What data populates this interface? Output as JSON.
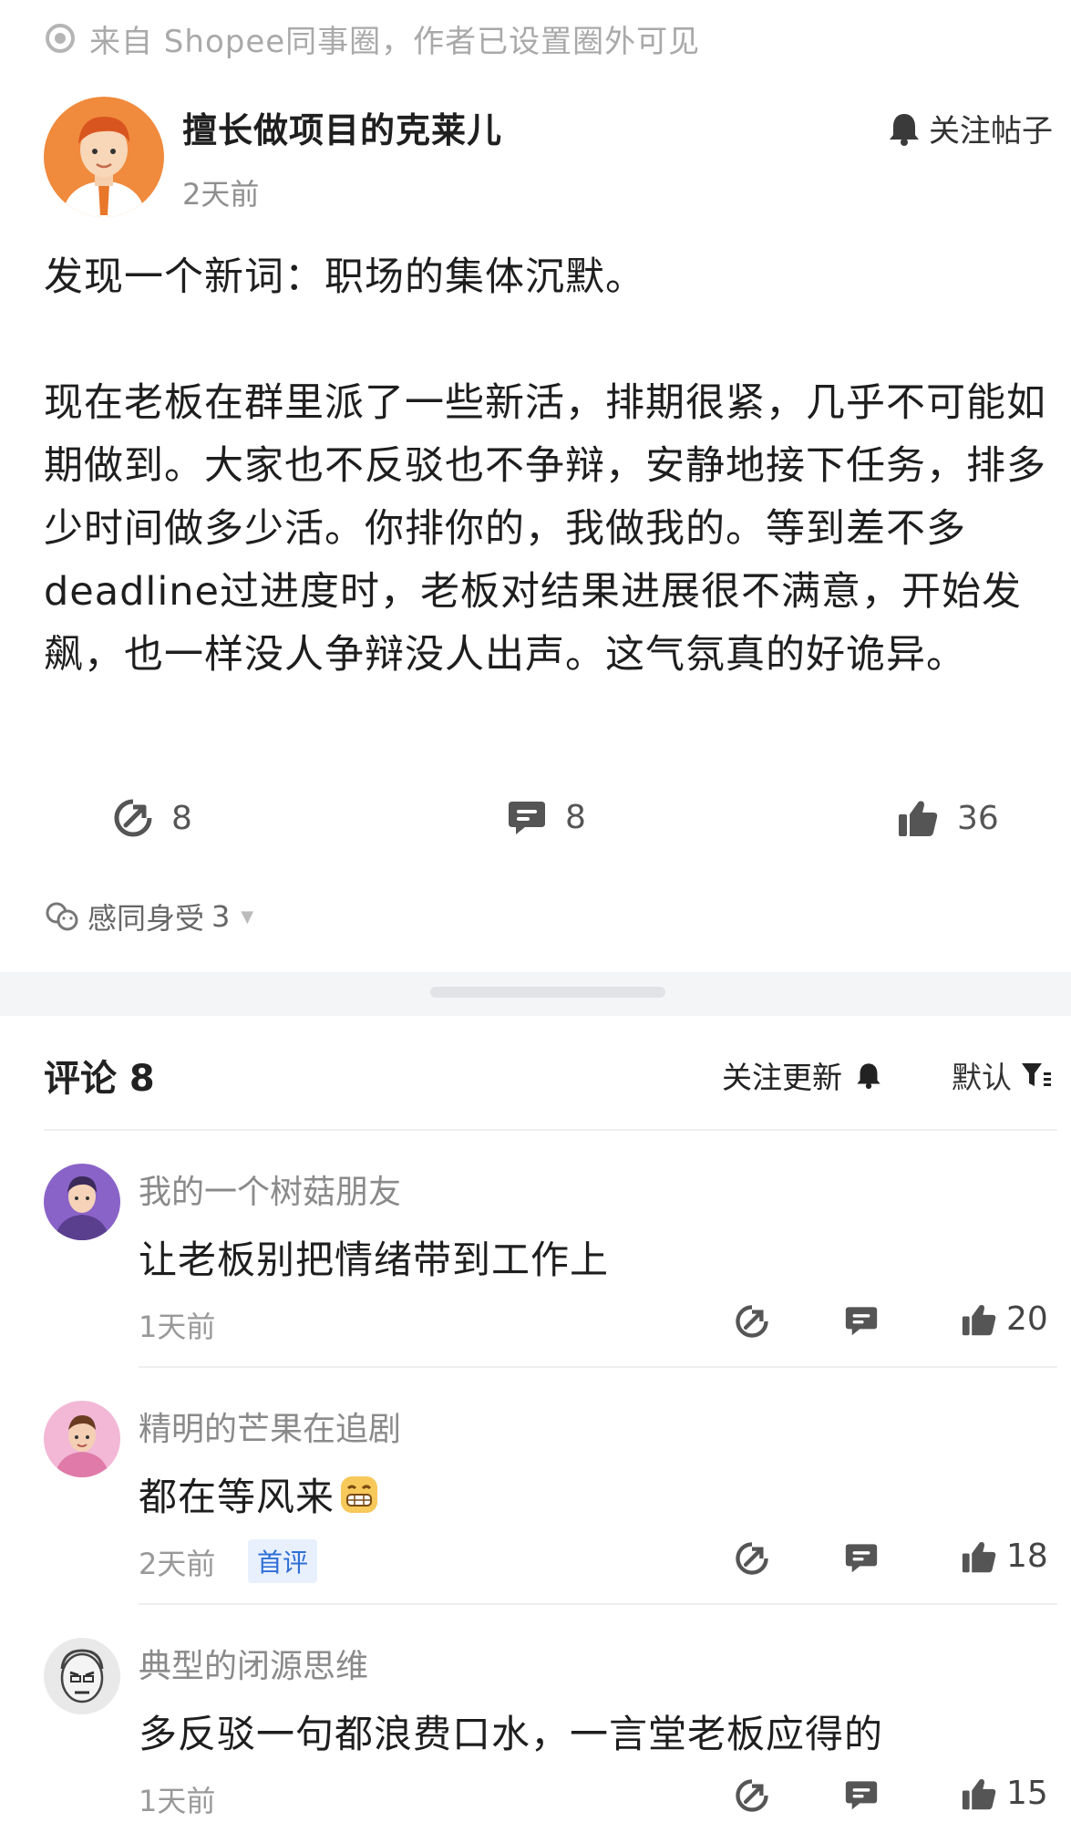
{
  "source_note": "来自 Shopee同事圈，作者已设置圈外可见",
  "post": {
    "author": "擅长做项目的克莱儿",
    "time": "2天前",
    "follow_label": "关注帖子",
    "paragraphs": [
      "发现一个新词：职场的集体沉默。",
      "现在老板在群里派了一些新活，排期很紧，几乎不可能如期做到。大家也不反驳也不争辩，安静地接下任务，排多少时间做多少活。你排你的，我做我的。等到差不多deadline过进度时，老板对结果进展很不满意，开始发飙，也一样没人争辩没人出声。这气氛真的好诡异。"
    ],
    "share_count": "8",
    "comment_count": "8",
    "like_count": "36",
    "reaction_label": "感同身受",
    "reaction_count": "3"
  },
  "comments_header": {
    "title": "评论 8",
    "follow_updates": "关注更新",
    "sort_label": "默认"
  },
  "comments": [
    {
      "name": "我的一个树菇朋友",
      "text": "让老板别把情绪带到工作上",
      "time": "1天前",
      "badge": "",
      "likes": "20"
    },
    {
      "name": "精明的芒果在追剧",
      "text": "都在等风来",
      "time": "2天前",
      "badge": "首评",
      "likes": "18"
    },
    {
      "name": "典型的闭源思维",
      "text": "多反驳一句都浪费口水，一言堂老板应得的",
      "time": "1天前",
      "badge": "",
      "likes": "15"
    }
  ],
  "icons": {
    "source": "circle-dot-icon",
    "bell": "bell-icon",
    "share": "share-arrow-icon",
    "comment": "comment-bubble-icon",
    "like": "thumbs-up-icon",
    "reaction": "reaction-emoji-icon",
    "filter": "filter-icon",
    "emoji": "grin-emoji-icon"
  },
  "colors": {
    "accent_blue": "#2f6fd6",
    "badge_bg": "#e8f0fd",
    "muted_text": "#8a8a8a",
    "avatar_orange": "#f08a3c"
  }
}
